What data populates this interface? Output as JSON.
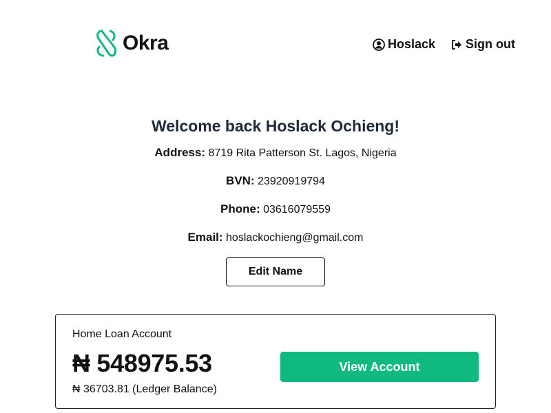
{
  "brand": {
    "name": "Okra",
    "accent_color": "#10b981"
  },
  "nav": {
    "user": {
      "icon": "user-circle-icon",
      "label": "Hoslack"
    },
    "signout": {
      "icon": "sign-out-icon",
      "label": "Sign out"
    }
  },
  "profile": {
    "welcome": "Welcome back Hoslack Ochieng!",
    "address": {
      "label": "Address:",
      "value": "8719 Rita Patterson St. Lagos, Nigeria"
    },
    "bvn": {
      "label": "BVN:",
      "value": "23920919794"
    },
    "phone": {
      "label": "Phone:",
      "value": "03616079559"
    },
    "email": {
      "label": "Email:",
      "value": "hoslackochieng@gmail.com"
    },
    "edit_button": "Edit Name"
  },
  "account": {
    "name": "Home Loan Account",
    "balance": "₦ 548975.53",
    "ledger": "₦ 36703.81 (Ledger Balance)",
    "view_button": "View Account"
  }
}
